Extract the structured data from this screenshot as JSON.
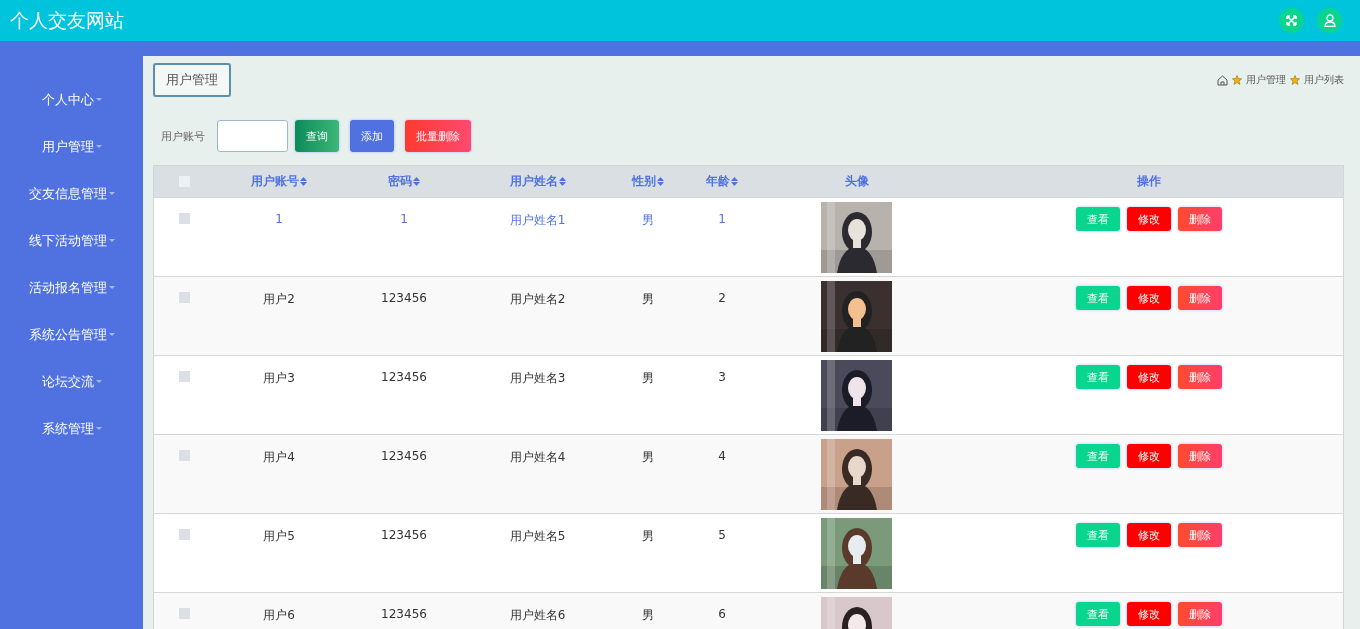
{
  "header": {
    "title": "个人交友网站"
  },
  "sidebar": {
    "items": [
      {
        "label": "个人中心"
      },
      {
        "label": "用户管理"
      },
      {
        "label": "交友信息管理"
      },
      {
        "label": "线下活动管理"
      },
      {
        "label": "活动报名管理"
      },
      {
        "label": "系统公告管理"
      },
      {
        "label": "论坛交流"
      },
      {
        "label": "系统管理"
      }
    ]
  },
  "page_tab": "用户管理",
  "breadcrumb": [
    "用户管理",
    "用户列表"
  ],
  "search": {
    "label": "用户账号",
    "buttons": [
      {
        "label": "查询",
        "kind": "query"
      },
      {
        "label": "添加",
        "kind": "add"
      },
      {
        "label": "批量删除",
        "kind": "delete"
      }
    ]
  },
  "table": {
    "select_all_checked": false,
    "columns": [
      {
        "label": "用户账号",
        "sortable": true
      },
      {
        "label": "密码",
        "sortable": true
      },
      {
        "label": "用户姓名",
        "sortable": true
      },
      {
        "label": "性别",
        "sortable": true
      },
      {
        "label": "年龄",
        "sortable": true
      },
      {
        "label": "头像",
        "sortable": false
      },
      {
        "label": "操作",
        "sortable": false
      }
    ],
    "rows": [
      {
        "account": "1",
        "password": "1",
        "name": "用户姓名1",
        "gender": "男",
        "age": "1",
        "hovered": true,
        "checked": false,
        "actions": [
          "查看",
          "修改",
          "删除"
        ]
      },
      {
        "account": "用户2",
        "password": "123456",
        "name": "用户姓名2",
        "gender": "男",
        "age": "2",
        "hovered": false,
        "checked": false,
        "actions": [
          "查看",
          "修改",
          "删除"
        ]
      },
      {
        "account": "用户3",
        "password": "123456",
        "name": "用户姓名3",
        "gender": "男",
        "age": "3",
        "hovered": false,
        "checked": false,
        "actions": [
          "查看",
          "修改",
          "删除"
        ]
      },
      {
        "account": "用户4",
        "password": "123456",
        "name": "用户姓名4",
        "gender": "男",
        "age": "4",
        "hovered": false,
        "checked": false,
        "actions": [
          "查看",
          "修改",
          "删除"
        ]
      },
      {
        "account": "用户5",
        "password": "123456",
        "name": "用户姓名5",
        "gender": "男",
        "age": "5",
        "hovered": false,
        "checked": false,
        "actions": [
          "查看",
          "修改",
          "删除"
        ]
      },
      {
        "account": "用户6",
        "password": "123456",
        "name": "用户姓名6",
        "gender": "男",
        "age": "6",
        "hovered": false,
        "checked": false,
        "actions": [
          "查看",
          "修改",
          "删除"
        ]
      }
    ]
  }
}
